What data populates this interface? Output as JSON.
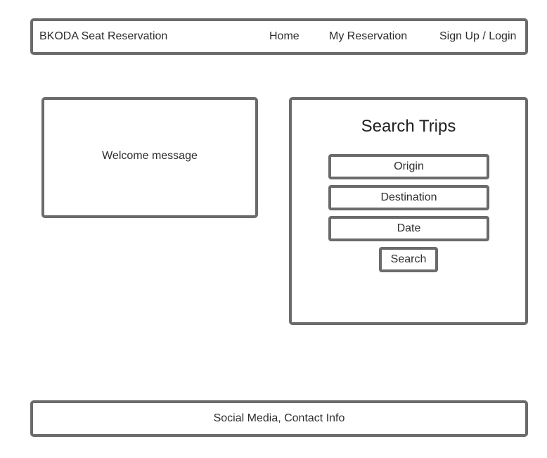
{
  "header": {
    "brand": "BKODA Seat Reservation",
    "nav": {
      "home": "Home",
      "my_reservation": "My Reservation",
      "login": "Sign Up / Login"
    }
  },
  "welcome": {
    "text": "Welcome message"
  },
  "search": {
    "title": "Search Trips",
    "origin": "Origin",
    "destination": "Destination",
    "date": "Date",
    "button": "Search"
  },
  "footer": {
    "text": "Social Media, Contact Info"
  },
  "colors": {
    "border": "#6b6b6b",
    "text": "#2e2e2e",
    "background": "#ffffff"
  }
}
